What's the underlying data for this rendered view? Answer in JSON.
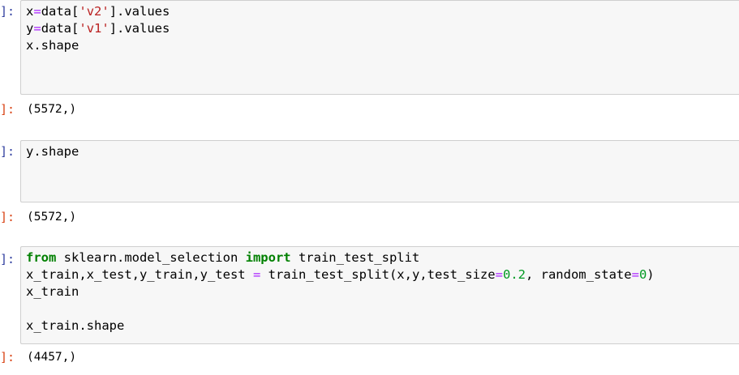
{
  "cells": [
    {
      "in_prompt": "]:",
      "code": {
        "line1": {
          "a": "x",
          "op": "=",
          "b": "data[",
          "str": "'v2'",
          "c": "].values"
        },
        "line2": {
          "a": "y",
          "op": "=",
          "b": "data[",
          "str": "'v1'",
          "c": "].values"
        },
        "line3": "x.shape"
      },
      "out_prompt": "]:",
      "output": "(5572,)"
    },
    {
      "in_prompt": "]:",
      "code": {
        "line1": "y.shape"
      },
      "out_prompt": "]:",
      "output": "(5572,)"
    },
    {
      "in_prompt": "]:",
      "code": {
        "line1": {
          "kw1": "from",
          "mod": " sklearn.model_selection ",
          "kw2": "import",
          "name": " train_test_split"
        },
        "line2": {
          "a": "x_train,x_test,y_train,y_test ",
          "op1": "=",
          "b": " train_test_split(x,y,test_size",
          "op2": "=",
          "n1": "0.2",
          "c": ", random_state",
          "op3": "=",
          "n2": "0",
          "d": ")"
        },
        "line3": "x_train",
        "line4": "",
        "line5": "x_train.shape"
      },
      "out_prompt": "]:",
      "output": "(4457,)"
    }
  ]
}
